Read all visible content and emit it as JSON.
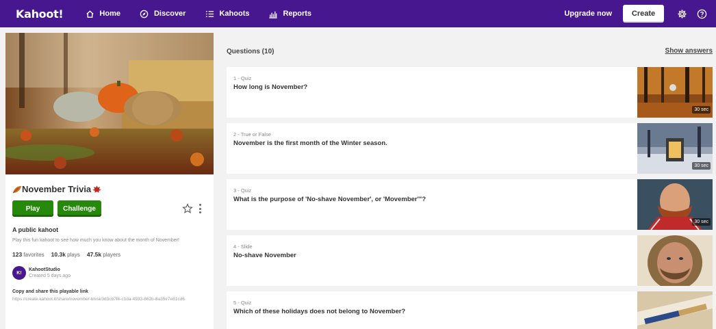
{
  "nav": {
    "logo": "Kahoot!",
    "items": [
      {
        "label": "Home",
        "icon": "home-icon"
      },
      {
        "label": "Discover",
        "icon": "compass-icon"
      },
      {
        "label": "Kahoots",
        "icon": "list-icon"
      },
      {
        "label": "Reports",
        "icon": "bar-chart-icon"
      }
    ],
    "upgrade": "Upgrade now",
    "create": "Create",
    "brand_color": "#46178f"
  },
  "kahoot": {
    "title": "November Trivia",
    "play_label": "Play",
    "challenge_label": "Challenge",
    "visibility": "A public kahoot",
    "description": "Play this fun kahoot to see how much you know about the month of November!",
    "favorites_count": "123",
    "favorites_label": "favorites",
    "plays_count": "10.3k",
    "plays_label": "plays",
    "players_count": "47.5k",
    "players_label": "players",
    "creator_name": "KahootStudio",
    "creator_initials": "K!",
    "created": "Created 5 days ago",
    "share_heading": "Copy and share this playable link",
    "share_link": "https://create.kahoot.it/share/november-trivia/3d3cb7f4-c1da-4933-862b-8a35e7e81cd6"
  },
  "questions": {
    "heading": "Questions (10)",
    "show_answers": "Show answers",
    "items": [
      {
        "type": "1 - Quiz",
        "text": "How long is November?",
        "time": "30 sec"
      },
      {
        "type": "2 - True or False",
        "text": "November is the first month of the Winter season.",
        "time": "30 sec"
      },
      {
        "type": "3 - Quiz",
        "text": "What is the purpose of 'No-shave November', or 'Movember'\"?",
        "time": "30 sec"
      },
      {
        "type": "4 - Slide",
        "text": "No-shave November",
        "time": ""
      },
      {
        "type": "5 - Quiz",
        "text": "Which of these holidays does not belong to November?",
        "time": ""
      }
    ]
  }
}
